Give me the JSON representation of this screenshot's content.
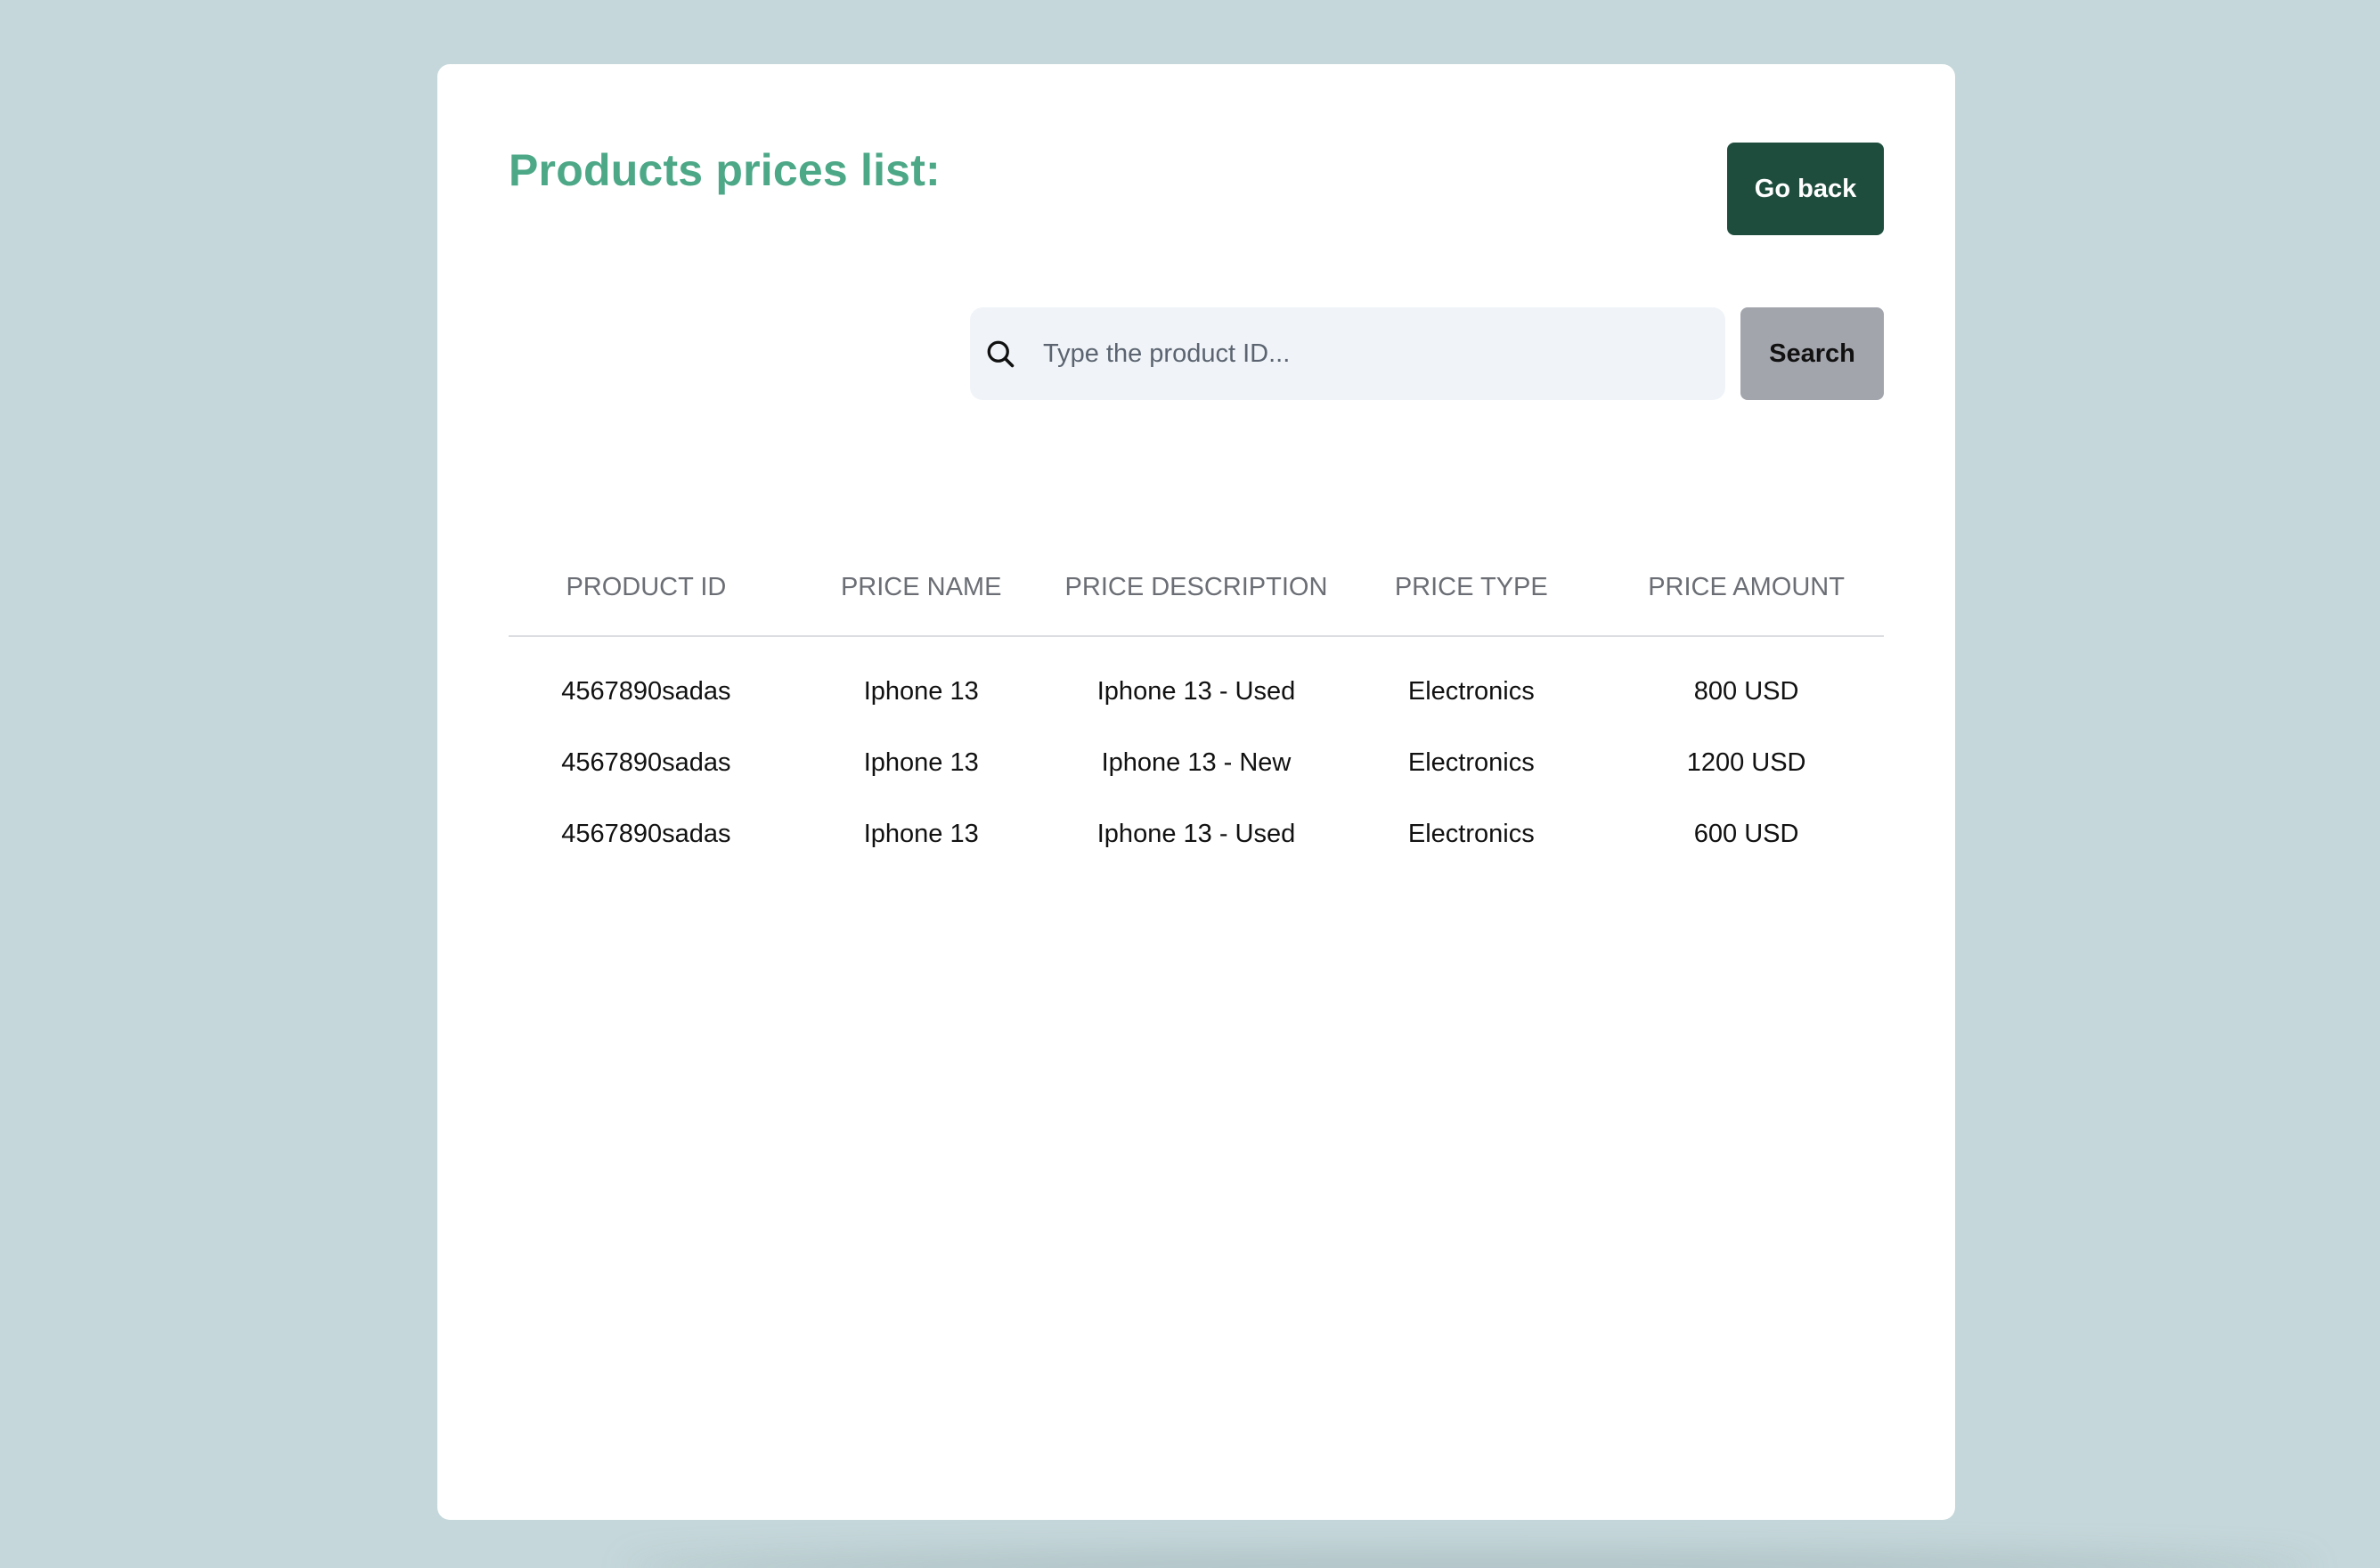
{
  "header": {
    "title": "Products prices list:",
    "go_back_label": "Go back"
  },
  "search": {
    "placeholder": "Type the product ID...",
    "value": "",
    "button_label": "Search",
    "icon": "search-icon"
  },
  "table": {
    "columns": [
      "PRODUCT ID",
      "PRICE NAME",
      "PRICE DESCRIPTION",
      "PRICE TYPE",
      "PRICE AMOUNT"
    ],
    "rows": [
      [
        "4567890sadas",
        "Iphone 13",
        "Iphone 13 - Used",
        "Electronics",
        "800 USD"
      ],
      [
        "4567890sadas",
        "Iphone 13",
        "Iphone 13 - New",
        "Electronics",
        "1200 USD"
      ],
      [
        "4567890sadas",
        "Iphone 13",
        "Iphone 13 - Used",
        "Electronics",
        "600 USD"
      ]
    ]
  },
  "colors": {
    "background": "#c5d7da",
    "title": "#4da888",
    "go_back_button": "#1f4d3d",
    "search_button": "#a3a5ad",
    "search_field": "#f0f4f8"
  }
}
